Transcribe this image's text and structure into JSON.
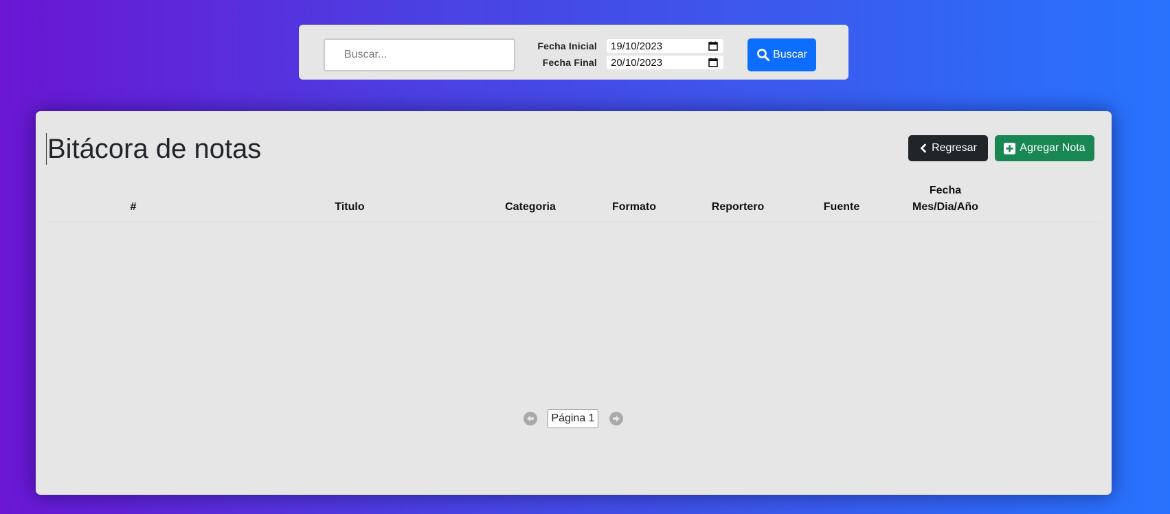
{
  "search": {
    "placeholder": "Buscar...",
    "value": "",
    "fecha_inicial_label": "Fecha Inicial",
    "fecha_inicial_value": "19/10/2023",
    "fecha_final_label": "Fecha Final",
    "fecha_final_value": "20/10/2023",
    "button_label": "Buscar"
  },
  "main": {
    "title": "Bitácora de notas",
    "back_label": "Regresar",
    "add_label": "Agregar Nota"
  },
  "table": {
    "headers": {
      "num": "#",
      "titulo": "Titulo",
      "categoria": "Categoria",
      "formato": "Formato",
      "reportero": "Reportero",
      "fuente": "Fuente",
      "fecha_line1": "Fecha",
      "fecha_line2": "Mes/Dia/Año"
    },
    "rows": []
  },
  "pagination": {
    "page_label": "Página 1"
  },
  "colors": {
    "primary": "#0d6efd",
    "dark": "#212529",
    "success": "#198754",
    "panel": "#e6e6e6",
    "gradient_start": "#6a16d3",
    "gradient_end": "#2773fd"
  },
  "icons": {
    "search_button": "search-icon",
    "calendar": "calendar-icon",
    "back": "chevron-left-icon",
    "add": "plus-square-icon",
    "prev": "arrow-left-circle-icon",
    "next": "arrow-right-circle-icon"
  }
}
